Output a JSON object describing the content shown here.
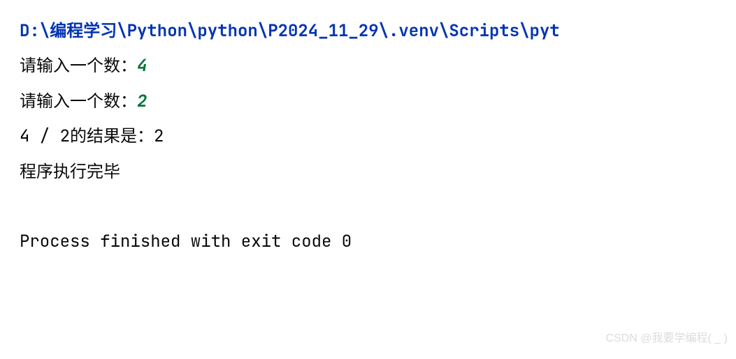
{
  "console": {
    "path": "D:\\编程学习\\Python\\python\\P2024_11_29\\.venv\\Scripts\\pyt",
    "lines": [
      {
        "prompt": "请输入一个数：",
        "input": "4"
      },
      {
        "prompt": "请输入一个数：",
        "input": "2"
      }
    ],
    "result": "4 / 2的结果是：2",
    "done": "程序执行完毕",
    "exit": "Process finished with exit code 0"
  },
  "watermark": "CSDN @我要学编程( _ )"
}
